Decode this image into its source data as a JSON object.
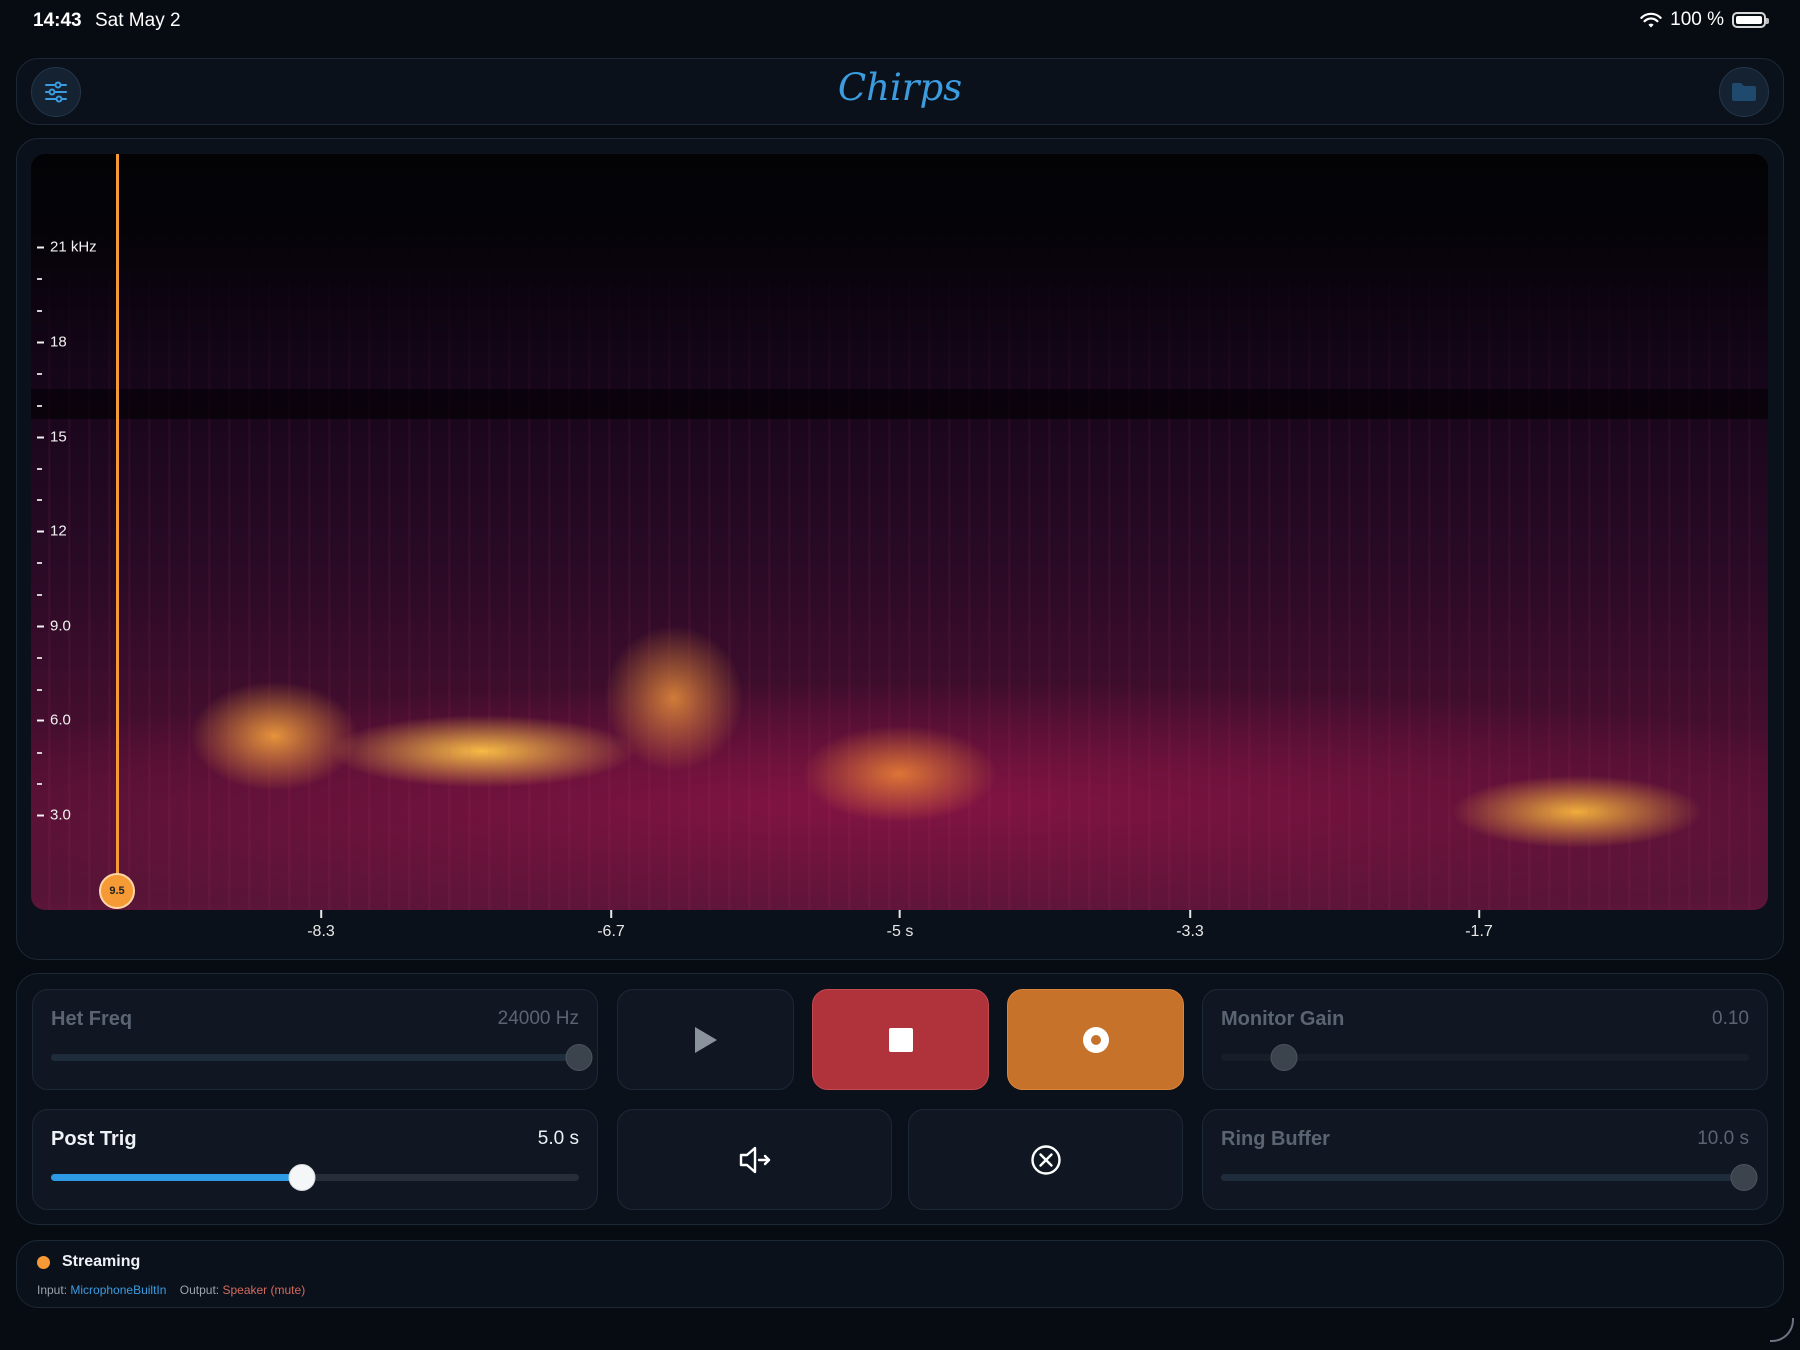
{
  "status_bar": {
    "time": "14:43",
    "date": "Sat May 2",
    "battery": "100 %"
  },
  "header": {
    "title": "Chirps",
    "left_icon": "sliders-icon",
    "right_icon": "folder-icon"
  },
  "spectrogram": {
    "y_axis_labels": [
      "21 kHz",
      "18",
      "15",
      "12",
      "9.0",
      "6.0",
      "3.0"
    ],
    "x_axis_labels": [
      "-8.3",
      "-6.7",
      "-5 s",
      "-3.3",
      "-1.7"
    ],
    "playhead_label": "9.5",
    "colors": {
      "playhead": "#f59a35"
    }
  },
  "controls": {
    "het_freq": {
      "label": "Het Freq",
      "value": "24000 Hz",
      "level": 1.0
    },
    "monitor_gain": {
      "label": "Monitor Gain",
      "value": "0.10",
      "level": 0.12
    },
    "post_trig": {
      "label": "Post Trig",
      "value": "5.0 s",
      "level": 0.475
    },
    "ring_buffer": {
      "label": "Ring Buffer",
      "value": "10.0 s",
      "level": 0.99
    },
    "buttons": [
      "play",
      "stop",
      "record",
      "speaker-output",
      "clear"
    ],
    "colors": {
      "stop": "#b0323a",
      "record": "#c7722a",
      "accent": "#2e9ae6"
    }
  },
  "footer": {
    "status": "Streaming",
    "input_label": "Input:",
    "input_value": "MicrophoneBuiltIn",
    "output_label": "Output:",
    "output_value": "Speaker (mute)"
  }
}
